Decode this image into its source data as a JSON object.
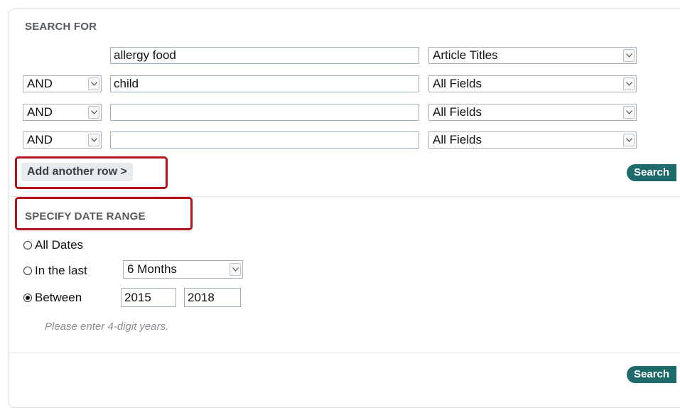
{
  "search": {
    "title": "SEARCH FOR",
    "rows": [
      {
        "operator": "",
        "term": "allergy food",
        "field": "Article Titles"
      },
      {
        "operator": "AND",
        "term": "child",
        "field": "All Fields"
      },
      {
        "operator": "AND",
        "term": "",
        "field": "All Fields"
      },
      {
        "operator": "AND",
        "term": "",
        "field": "All Fields"
      }
    ],
    "add_row_label": "Add another row >",
    "search_label": "Search"
  },
  "date_range": {
    "title": "SPECIFY DATE RANGE",
    "options": {
      "all_dates": "All Dates",
      "in_the_last": "In the last",
      "between": "Between"
    },
    "selected": "between",
    "last_period": "6 Months",
    "from_year": "2015",
    "to_year": "2018",
    "hint": "Please enter 4-digit years.",
    "search_label": "Search"
  },
  "colors": {
    "highlight": "#b3141b",
    "button": "#1f6a6b"
  }
}
